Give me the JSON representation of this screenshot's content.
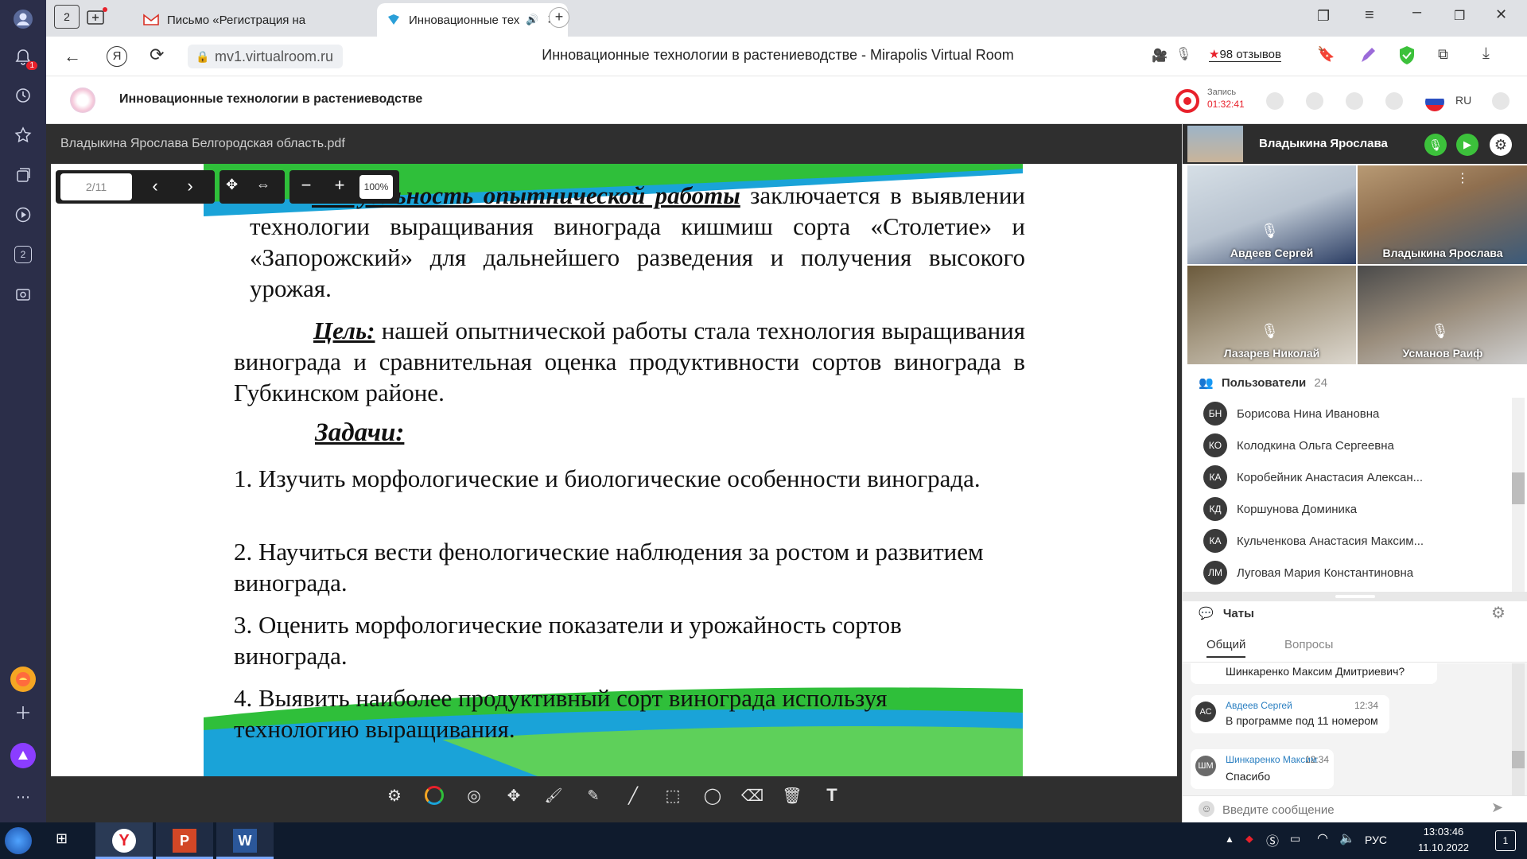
{
  "browser": {
    "tabs": [
      {
        "label": "Письмо «Регистрация на"
      },
      {
        "label": "Инновационные тех"
      }
    ],
    "address": "mv1.virtualroom.ru",
    "page_title": "Инновационные технологии в растениеводстве - Mirapolis Virtual Room",
    "reviews": "98 отзывов",
    "rail_badge": "1",
    "rail_counter": "2"
  },
  "app": {
    "title": "Инновационные технологии в растениеводстве",
    "record_label": "Запись",
    "record_time": "01:32:41",
    "language": "RU"
  },
  "doc": {
    "filename": "Владыкина Ярослава Белгородская область.pdf",
    "page_indicator": "2/11",
    "zoom": "100%"
  },
  "slide": {
    "p1_heading": "Актуальность опытнической работы",
    "p1_rest": "заключается в выявлении технологии выращивания винограда кишмиш сорта «Столетие» и «Запорожский» для дальнейшего разведения и получения высокого урожая.",
    "goal_label": "Цель:",
    "goal_text": "нашей опытнической работы стала технология выращивания винограда и сравнительная оценка продуктивности сортов винограда в Губкинском районе.",
    "tasks_label": "Задачи:",
    "tasks": [
      "1. Изучить морфологические и биологические особенности винограда.",
      "2. Научиться вести фенологические наблюдения за ростом и развитием винограда.",
      "3. Оценить морфологические показатели и урожайность сортов винограда.",
      "4. Выявить наиболее продуктивный сорт винограда используя технологию выращивания."
    ]
  },
  "presenter": {
    "name": "Владыкина Ярослава"
  },
  "videos": [
    {
      "name": "Авдеев Сергей"
    },
    {
      "name": "Владыкина Ярослава"
    },
    {
      "name": "Лазарев Николай"
    },
    {
      "name": "Усманов Раиф"
    }
  ],
  "users": {
    "label": "Пользователи",
    "count": "24",
    "items": [
      {
        "initials": "БН",
        "name": "Борисова Нина Ивановна"
      },
      {
        "initials": "КО",
        "name": "Колодкина Ольга Сергеевна"
      },
      {
        "initials": "КА",
        "name": "Коробейник Анастасия Алексан..."
      },
      {
        "initials": "КД",
        "name": "Коршунова Доминика"
      },
      {
        "initials": "КА",
        "name": "Кульченкова Анастасия Максим..."
      },
      {
        "initials": "ЛМ",
        "name": "Луговая Мария Константиновна"
      }
    ]
  },
  "chat": {
    "label": "Чаты",
    "tabs": [
      "Общий",
      "Вопросы"
    ],
    "prev_message": "Шинкаренко Максим Дмитриевич?",
    "messages": [
      {
        "initials": "АС",
        "author": "Авдеев Сергей",
        "time": "12:34",
        "text": "В программе под 11 номером"
      },
      {
        "initials": "ШМ",
        "author": "Шинкаренко Максим",
        "time": "12:34",
        "text": "Спасибо"
      }
    ],
    "input_placeholder": "Введите сообщение"
  },
  "taskbar": {
    "lang": "РУС",
    "time": "13:03:46",
    "date": "11.10.2022",
    "notif": "1"
  },
  "colors": {
    "accent_green": "#3cc13b",
    "record_red": "#e8212b",
    "rail_bg": "#2b2e49"
  }
}
